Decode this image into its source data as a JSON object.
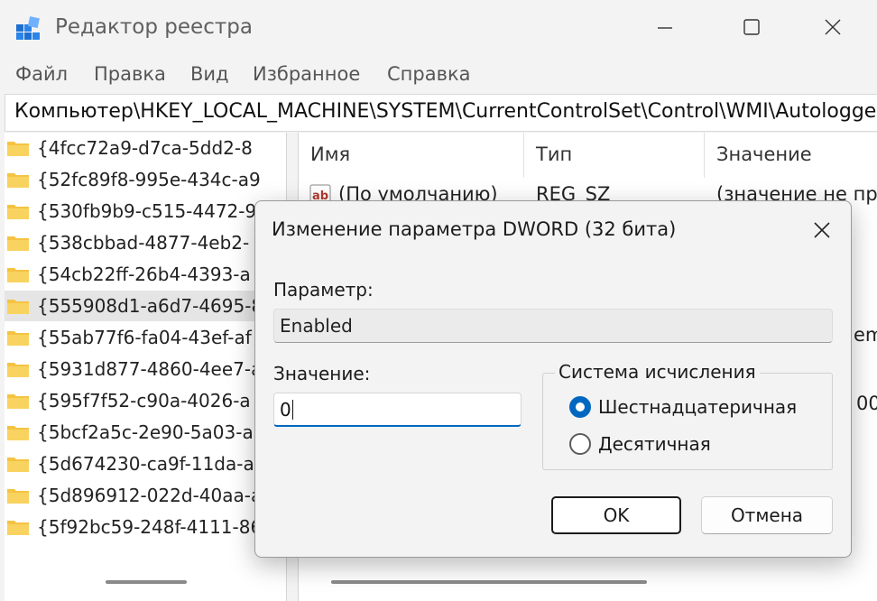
{
  "window": {
    "title": "Редактор реестра"
  },
  "menu": [
    "Файл",
    "Правка",
    "Вид",
    "Избранное",
    "Справка"
  ],
  "address": "Компьютер\\HKEY_LOCAL_MACHINE\\SYSTEM\\CurrentControlSet\\Control\\WMI\\Autologger",
  "tree": {
    "items": [
      "{4fcc72a9-d7ca-5dd2-8",
      "{52fc89f8-995e-434c-a9",
      "{530fb9b9-c515-4472-9",
      "{538cbbad-4877-4eb2-",
      "{54cb22ff-26b4-4393-a",
      "{555908d1-a6d7-4695-8",
      "{55ab77f6-fa04-43ef-af",
      "{5931d877-4860-4ee7-a",
      "{595f7f52-c90a-4026-a",
      "{5bcf2a5c-2e90-5a03-a",
      "{5d674230-ca9f-11da-a",
      "{5d896912-022d-40aa-a",
      "{5f92bc59-248f-4111-86"
    ],
    "selected_index": 5
  },
  "list": {
    "columns": [
      "Имя",
      "Тип",
      "Значение"
    ],
    "rows": [
      {
        "name": "(По умолчанию)",
        "type": "REG_SZ",
        "value": "(значение не пр"
      }
    ],
    "partial_right_texts": [
      "em",
      "00"
    ]
  },
  "dialog": {
    "title": "Изменение параметра DWORD (32 бита)",
    "param_label": "Параметр:",
    "param_value": "Enabled",
    "value_label": "Значение:",
    "value_value": "0",
    "base_group_label": "Система исчисления",
    "radio_hex": "Шестнадцатеричная",
    "radio_dec": "Десятичная",
    "selected_base": "hex",
    "ok_label": "OK",
    "cancel_label": "Отмена"
  },
  "colors": {
    "accent": "#0067c0",
    "folder": "#f5c342",
    "background": "#f3f3f3"
  }
}
